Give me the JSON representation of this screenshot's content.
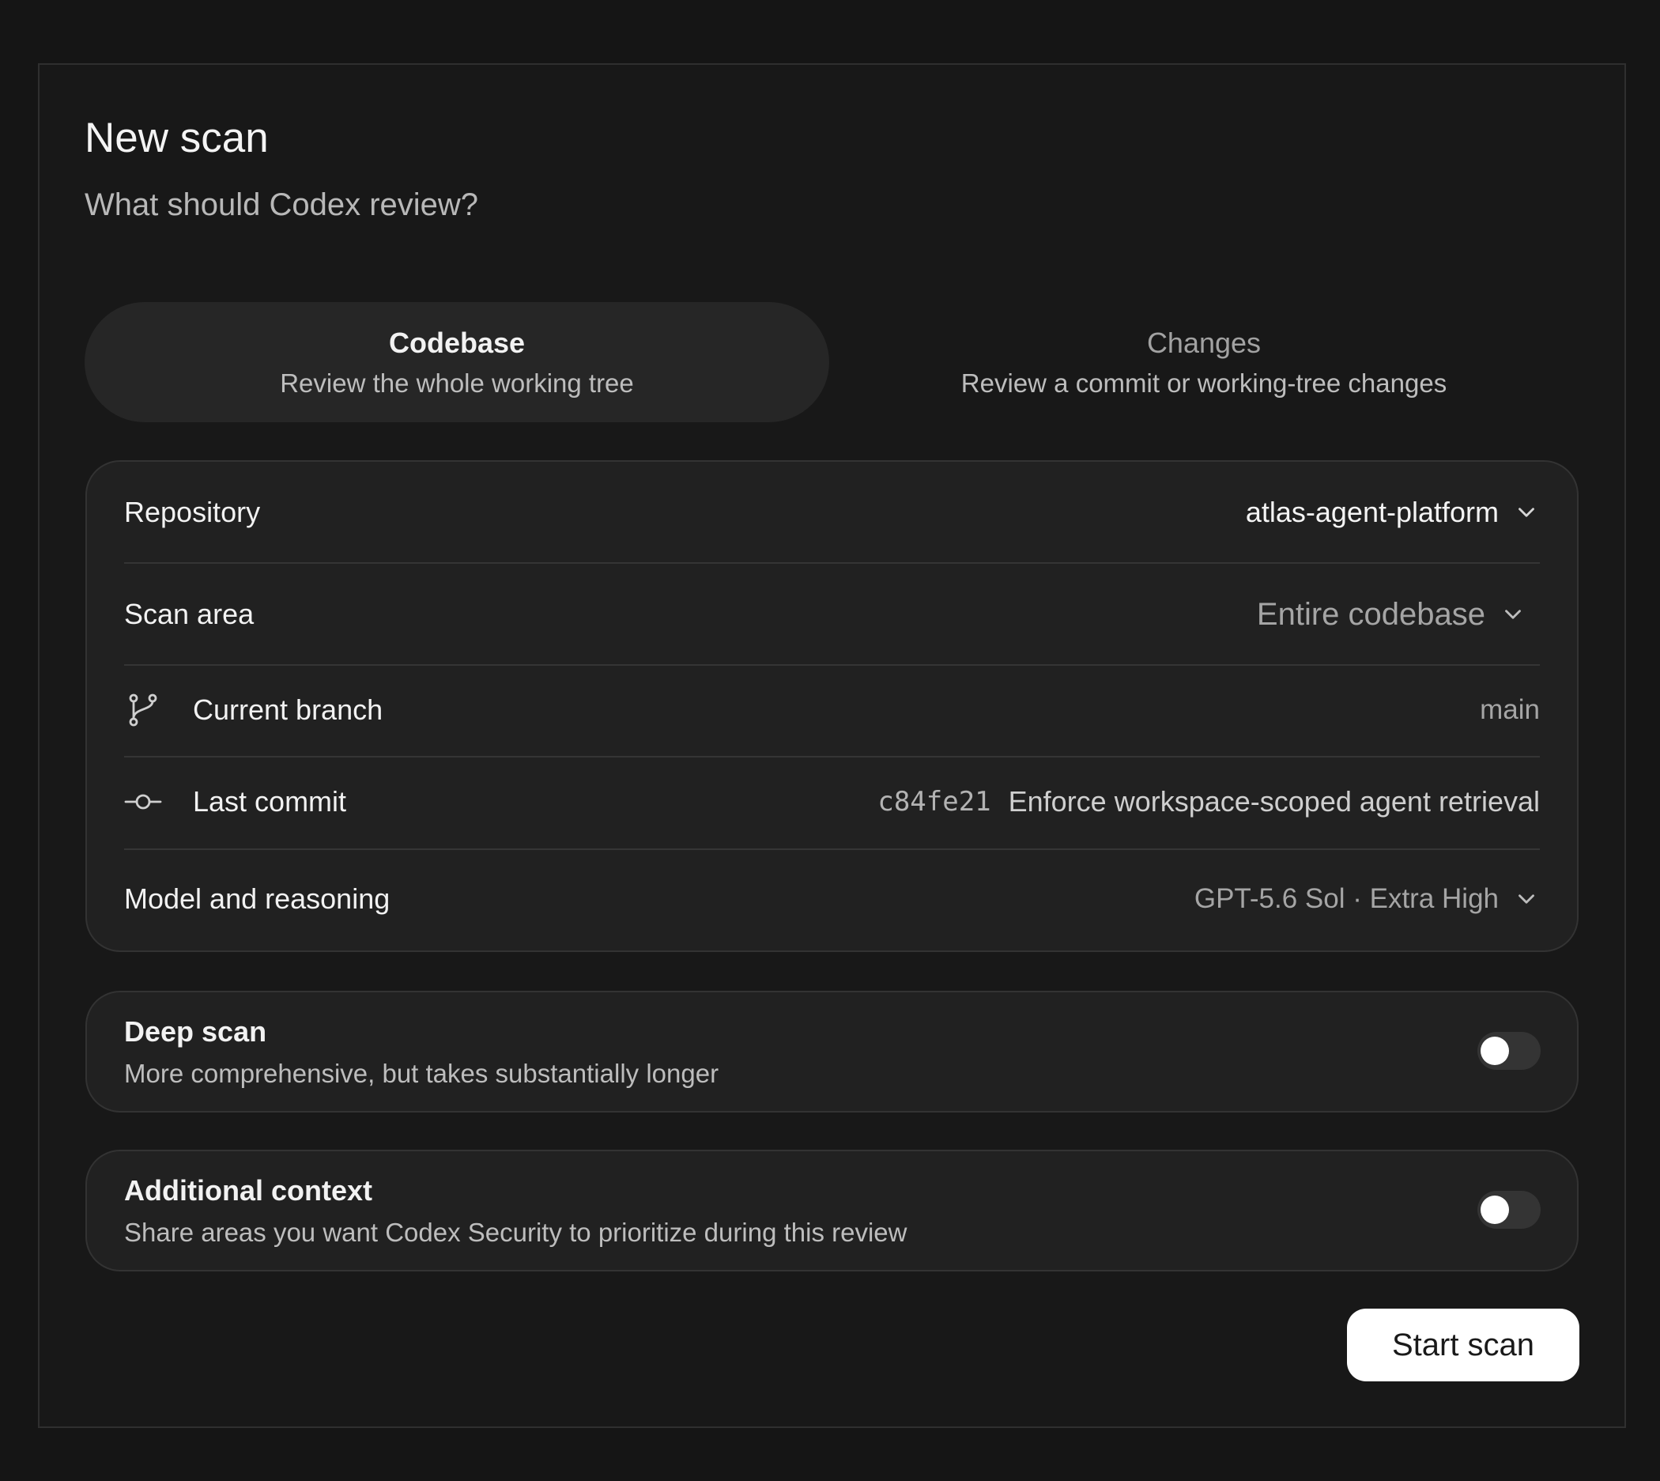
{
  "header": {
    "title": "New scan",
    "subtitle": "What should Codex review?"
  },
  "mode_tabs": [
    {
      "title": "Codebase",
      "description": "Review the whole working tree",
      "selected": true
    },
    {
      "title": "Changes",
      "description": "Review a commit or working-tree changes",
      "selected": false
    }
  ],
  "settings": {
    "repository": {
      "label": "Repository",
      "value": "atlas-agent-platform"
    },
    "scan_area": {
      "label": "Scan area",
      "value": "Entire codebase"
    },
    "current_branch": {
      "label": "Current branch",
      "value": "main",
      "icon": "git-branch-icon"
    },
    "last_commit": {
      "label": "Last commit",
      "hash": "c84fe21",
      "message": "Enforce workspace-scoped agent retrieval",
      "icon": "git-commit-icon"
    },
    "model": {
      "label": "Model and reasoning",
      "value": "GPT-5.6 Sol · Extra High"
    }
  },
  "options": {
    "deep_scan": {
      "title": "Deep scan",
      "description": "More comprehensive, but takes substantially longer",
      "enabled": false
    },
    "additional_context": {
      "title": "Additional context",
      "description": "Share areas you want Codex Security to prioritize during this review",
      "enabled": false
    }
  },
  "actions": {
    "start_label": "Start scan"
  },
  "colors": {
    "background": "#151515",
    "panel": "#181818",
    "card": "#212121",
    "active_tab": "#262626",
    "toggle_off": "#343434",
    "primary_button": "#ffffff"
  }
}
